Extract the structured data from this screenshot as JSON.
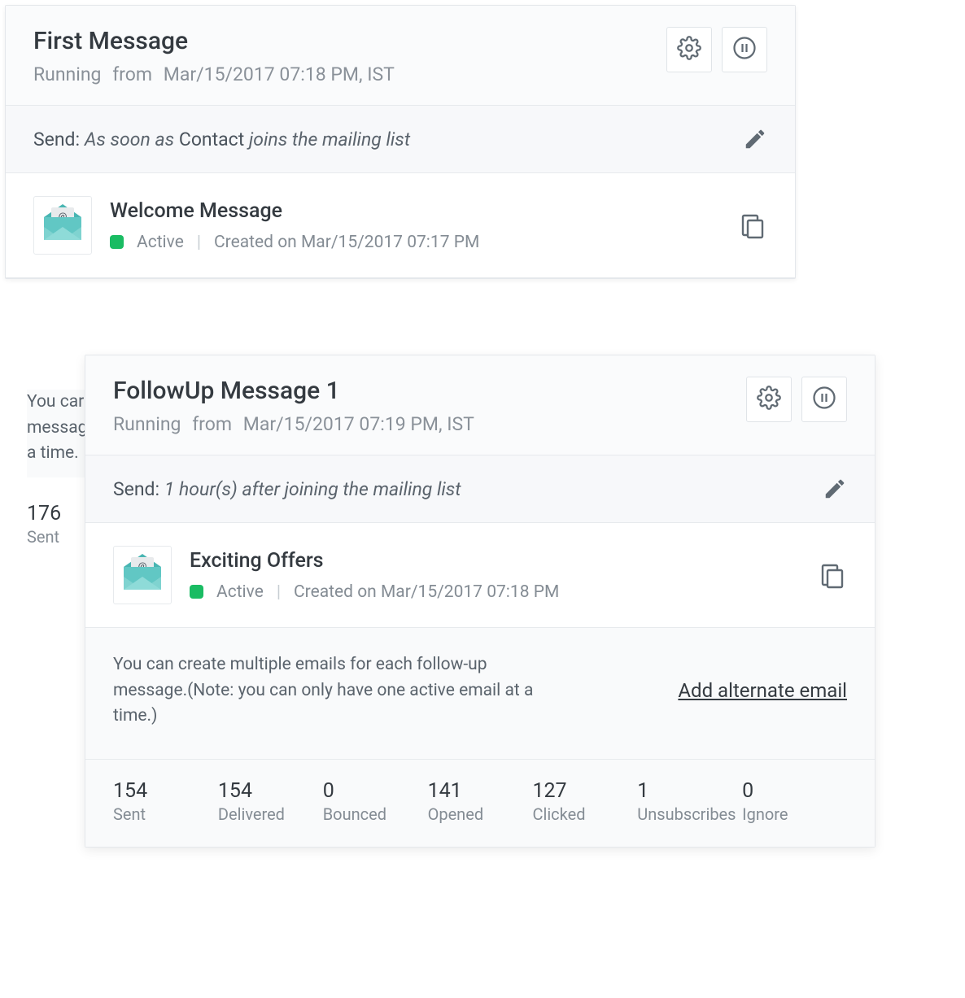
{
  "card1": {
    "title": "First Message",
    "status": "Running",
    "from_label": "from",
    "from_value": "Mar/15/2017 07:18 PM, IST",
    "send_prefix": "Send:",
    "send_i1": "As soon as",
    "send_plain": "Contact",
    "send_i2": "joins the mailing list",
    "msg_title": "Welcome Message",
    "msg_status": "Active",
    "msg_created": "Created on Mar/15/2017 07:17 PM",
    "note_frag": "You car\nmessag\na time.",
    "stat_num": "176",
    "stat_lbl": "Sent"
  },
  "card2": {
    "title": "FollowUp Message 1",
    "status": "Running",
    "from_label": "from",
    "from_value": "Mar/15/2017 07:19 PM, IST",
    "send_prefix": "Send:",
    "send_i1": "1  hour(s) after  joining the mailing list",
    "msg_title": "Exciting Offers",
    "msg_status": "Active",
    "msg_created": "Created on Mar/15/2017 07:18 PM",
    "note": "You can create multiple emails for each follow-up message.(Note: you can only have one active email at a time.)",
    "add_link": "Add alternate email",
    "stats": [
      {
        "num": "154",
        "lbl": "Sent"
      },
      {
        "num": "154",
        "lbl": "Delivered"
      },
      {
        "num": "0",
        "lbl": "Bounced"
      },
      {
        "num": "141",
        "lbl": "Opened"
      },
      {
        "num": "127",
        "lbl": "Clicked"
      },
      {
        "num": "1",
        "lbl": "Unsubscribes"
      },
      {
        "num": "0",
        "lbl": "Ignore"
      }
    ]
  }
}
